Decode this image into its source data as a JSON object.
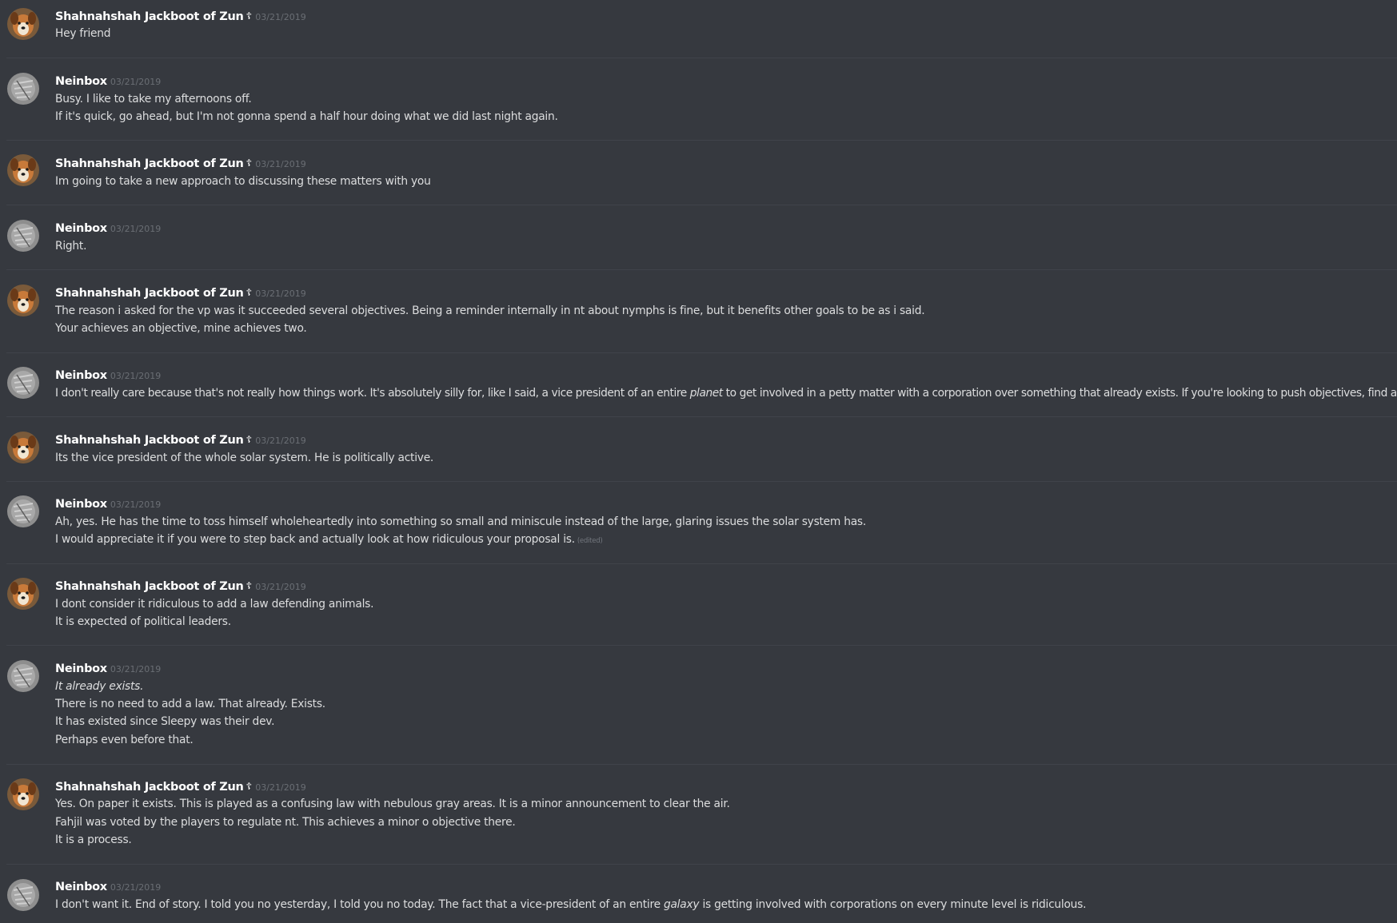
{
  "users": {
    "shah": {
      "name": "Shahnahshah Jackboot of Zun",
      "badge_icon": "cross-icon",
      "badge_glyph": "☦",
      "avatar": "dog-avatar",
      "avatar_colors": [
        "#c87a3a",
        "#f1e6d2",
        "#6a3a18"
      ]
    },
    "nein": {
      "name": "Neinbox",
      "avatar": "grey-sketch-avatar",
      "avatar_colors": [
        "#8e8e8e",
        "#cfcfcf",
        "#5e5e5e"
      ]
    }
  },
  "messages": [
    {
      "user": "Shahnahshah Jackboot of Zun",
      "timestamp": "03/21/2019",
      "lines": [
        "Hey friend"
      ]
    },
    {
      "user": "Neinbox",
      "timestamp": "03/21/2019",
      "lines": [
        "Busy. I like to take my afternoons off.",
        "If it's quick, go ahead, but I'm not gonna spend a half hour doing what we did last night again."
      ]
    },
    {
      "user": "Shahnahshah Jackboot of Zun",
      "timestamp": "03/21/2019",
      "lines": [
        "Im going to take a new approach to discussing these matters with you"
      ]
    },
    {
      "user": "Neinbox",
      "timestamp": "03/21/2019",
      "lines": [
        "Right."
      ]
    },
    {
      "user": "Shahnahshah Jackboot of Zun",
      "timestamp": "03/21/2019",
      "lines": [
        "The reason i asked for the vp was it succeeded several objectives. Being a reminder internally in nt about nymphs is fine, but it benefits other goals to be as i said.",
        "Your achieves an objective, mine achieves two."
      ]
    },
    {
      "user": "Neinbox",
      "timestamp": "03/21/2019",
      "lines": [
        {
          "before": "I don't really care because that's not really how things work. It's absolutely silly for, like I said, a vice president of an entire ",
          "italic": "planet",
          "after": " to get involved in a petty matter with a corporation over something that already exists. If you're looking to push objectives, find another angle."
        }
      ]
    },
    {
      "user": "Shahnahshah Jackboot of Zun",
      "timestamp": "03/21/2019",
      "lines": [
        "Its the vice president of the whole solar system. He is politically active."
      ]
    },
    {
      "user": "Neinbox",
      "timestamp": "03/21/2019",
      "lines": [
        "Ah, yes. He has the time to toss himself wholeheartedly into something so small and miniscule instead of the large, glaring issues the solar system has.",
        "I would appreciate it if you were to step back and actually look at how ridiculous your proposal is."
      ],
      "edited_label": "(edited)"
    },
    {
      "user": "Shahnahshah Jackboot of Zun",
      "timestamp": "03/21/2019",
      "lines": [
        "I dont consider it ridiculous to add a law defending animals.",
        "It is expected of political leaders."
      ]
    },
    {
      "user": "Neinbox",
      "timestamp": "03/21/2019",
      "lines": [
        "It already exists.",
        "There is no need to add a law. That already. Exists.",
        "It has existed since Sleepy was their dev.",
        "Perhaps even before that."
      ]
    },
    {
      "user": "Shahnahshah Jackboot of Zun",
      "timestamp": "03/21/2019",
      "lines": [
        "Yes. On paper it exists. This is played as a confusing law with nebulous gray areas. It is a minor announcement to clear the air.",
        "Fahjil was voted by the players to regulate nt. This achieves a minor o objective there.",
        "It is a process."
      ]
    },
    {
      "user": "Neinbox",
      "timestamp": "03/21/2019",
      "lines": [
        {
          "before": "I don't want it. End of story. I told you no yesterday, I told you no today. The fact that a vice-president of an entire ",
          "italic": "galaxy",
          "after": " is getting involved with corporations on every minute level is ridiculous."
        }
      ]
    }
  ],
  "colors": {
    "background": "#36393f",
    "divider": "#40434a",
    "username": "#ffffff",
    "timestamp": "#6a6e74",
    "text": "#dcddde"
  }
}
